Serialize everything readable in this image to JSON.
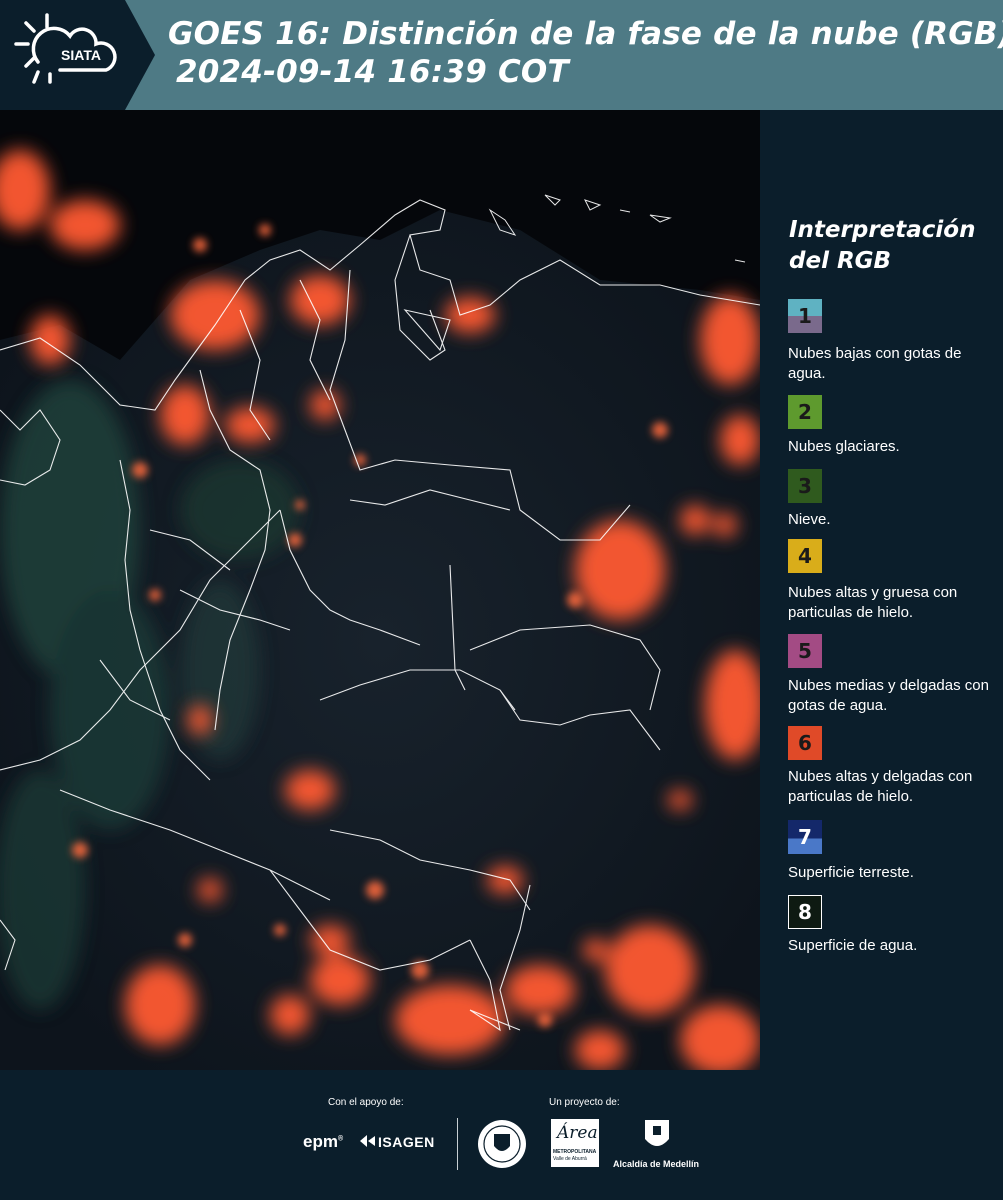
{
  "header": {
    "title_line1": "GOES 16: Distinción de la fase de la nube (RGB)",
    "title_line2": "2024-09-14 16:39 COT",
    "logo_text": "SIATA",
    "background_color": "#4e7a85"
  },
  "legend": {
    "title_line1": "Interpretación",
    "title_line2": "del RGB",
    "items": [
      {
        "number": "1",
        "label": "Nubes bajas con gotas de agua.",
        "color_top": "#5fb2c2",
        "color_bottom": "#7a6a8c"
      },
      {
        "number": "2",
        "label": "Nubes glaciares.",
        "color": "#5e9a2e"
      },
      {
        "number": "3",
        "label": "Nieve.",
        "color": "#2f5a1e"
      },
      {
        "number": "4",
        "label": "Nubes altas y gruesa con particulas de hielo.",
        "color": "#d9ad1a"
      },
      {
        "number": "5",
        "label": "Nubes medias y delgadas con gotas de agua.",
        "color": "#a34b84"
      },
      {
        "number": "6",
        "label": "Nubes altas y delgadas con particulas de hielo.",
        "color": "#e04a28"
      },
      {
        "number": "7",
        "label": "Superficie terreste.",
        "color_top": "#14286a",
        "color_bottom": "#4a78c8"
      },
      {
        "number": "8",
        "label": "Superficie de agua.",
        "color": "#0e1a12"
      }
    ]
  },
  "footer": {
    "support_label": "Con el apoyo de:",
    "project_label": "Un proyecto de:",
    "epm": "epm",
    "isagen": "ISAGEN",
    "metropolitana_line1": "METROPOLITANA",
    "metropolitana_line2": "Valle de Aburrá",
    "area_script": "Área",
    "alcaldia": "Alcaldía de Medellín"
  },
  "map": {
    "cloud_color": "#ff5a32",
    "border_color": "#ffffff"
  }
}
